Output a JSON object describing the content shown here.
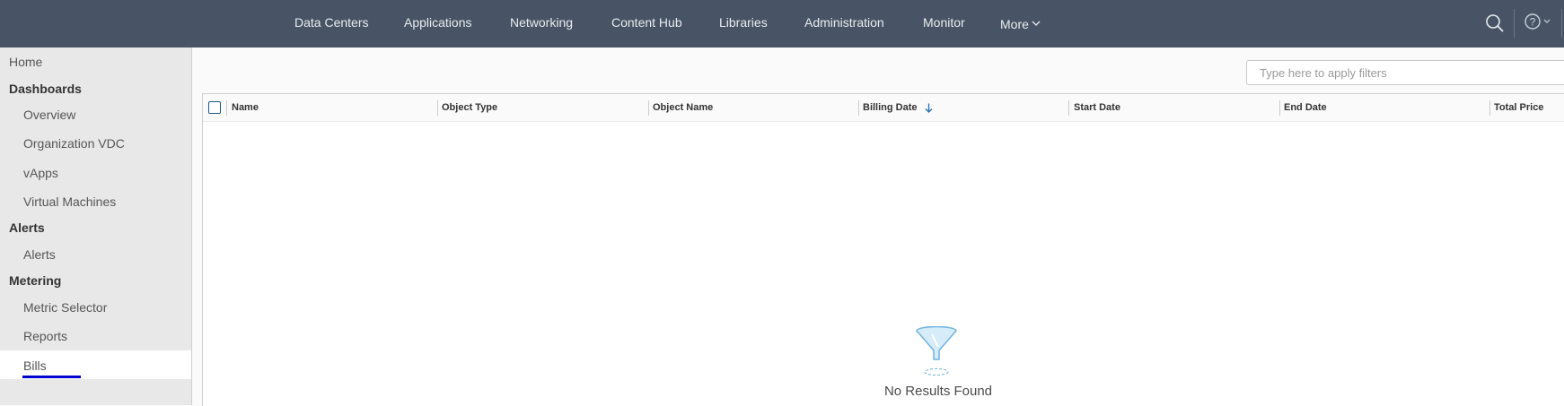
{
  "header": {
    "nav": [
      "Data Centers",
      "Applications",
      "Networking",
      "Content Hub",
      "Libraries",
      "Administration",
      "Monitor"
    ],
    "more_label": "More"
  },
  "sidebar": {
    "home": "Home",
    "dashboards": {
      "title": "Dashboards",
      "items": [
        "Overview",
        "Organization VDC",
        "vApps",
        "Virtual Machines"
      ]
    },
    "alerts": {
      "title": "Alerts",
      "items": [
        "Alerts"
      ]
    },
    "metering": {
      "title": "Metering",
      "items": [
        "Metric Selector",
        "Reports",
        "Bills"
      ]
    },
    "active_item": "Bills"
  },
  "filter": {
    "placeholder": "Type here to apply filters",
    "value": ""
  },
  "table": {
    "columns": [
      "Name",
      "Object Type",
      "Object Name",
      "Billing Date",
      "Start Date",
      "End Date",
      "Total Price"
    ],
    "sorted_column": "Billing Date",
    "sort_direction": "descending",
    "rows": []
  },
  "empty_state": {
    "text": "No Results Found",
    "icon": "funnel-icon"
  },
  "colors": {
    "header_bg": "#485465",
    "active_underline": "#0000cc",
    "checkbox_border": "#1d5a85",
    "sort_arrow": "#2a74b8",
    "funnel": "#6fb3de"
  }
}
